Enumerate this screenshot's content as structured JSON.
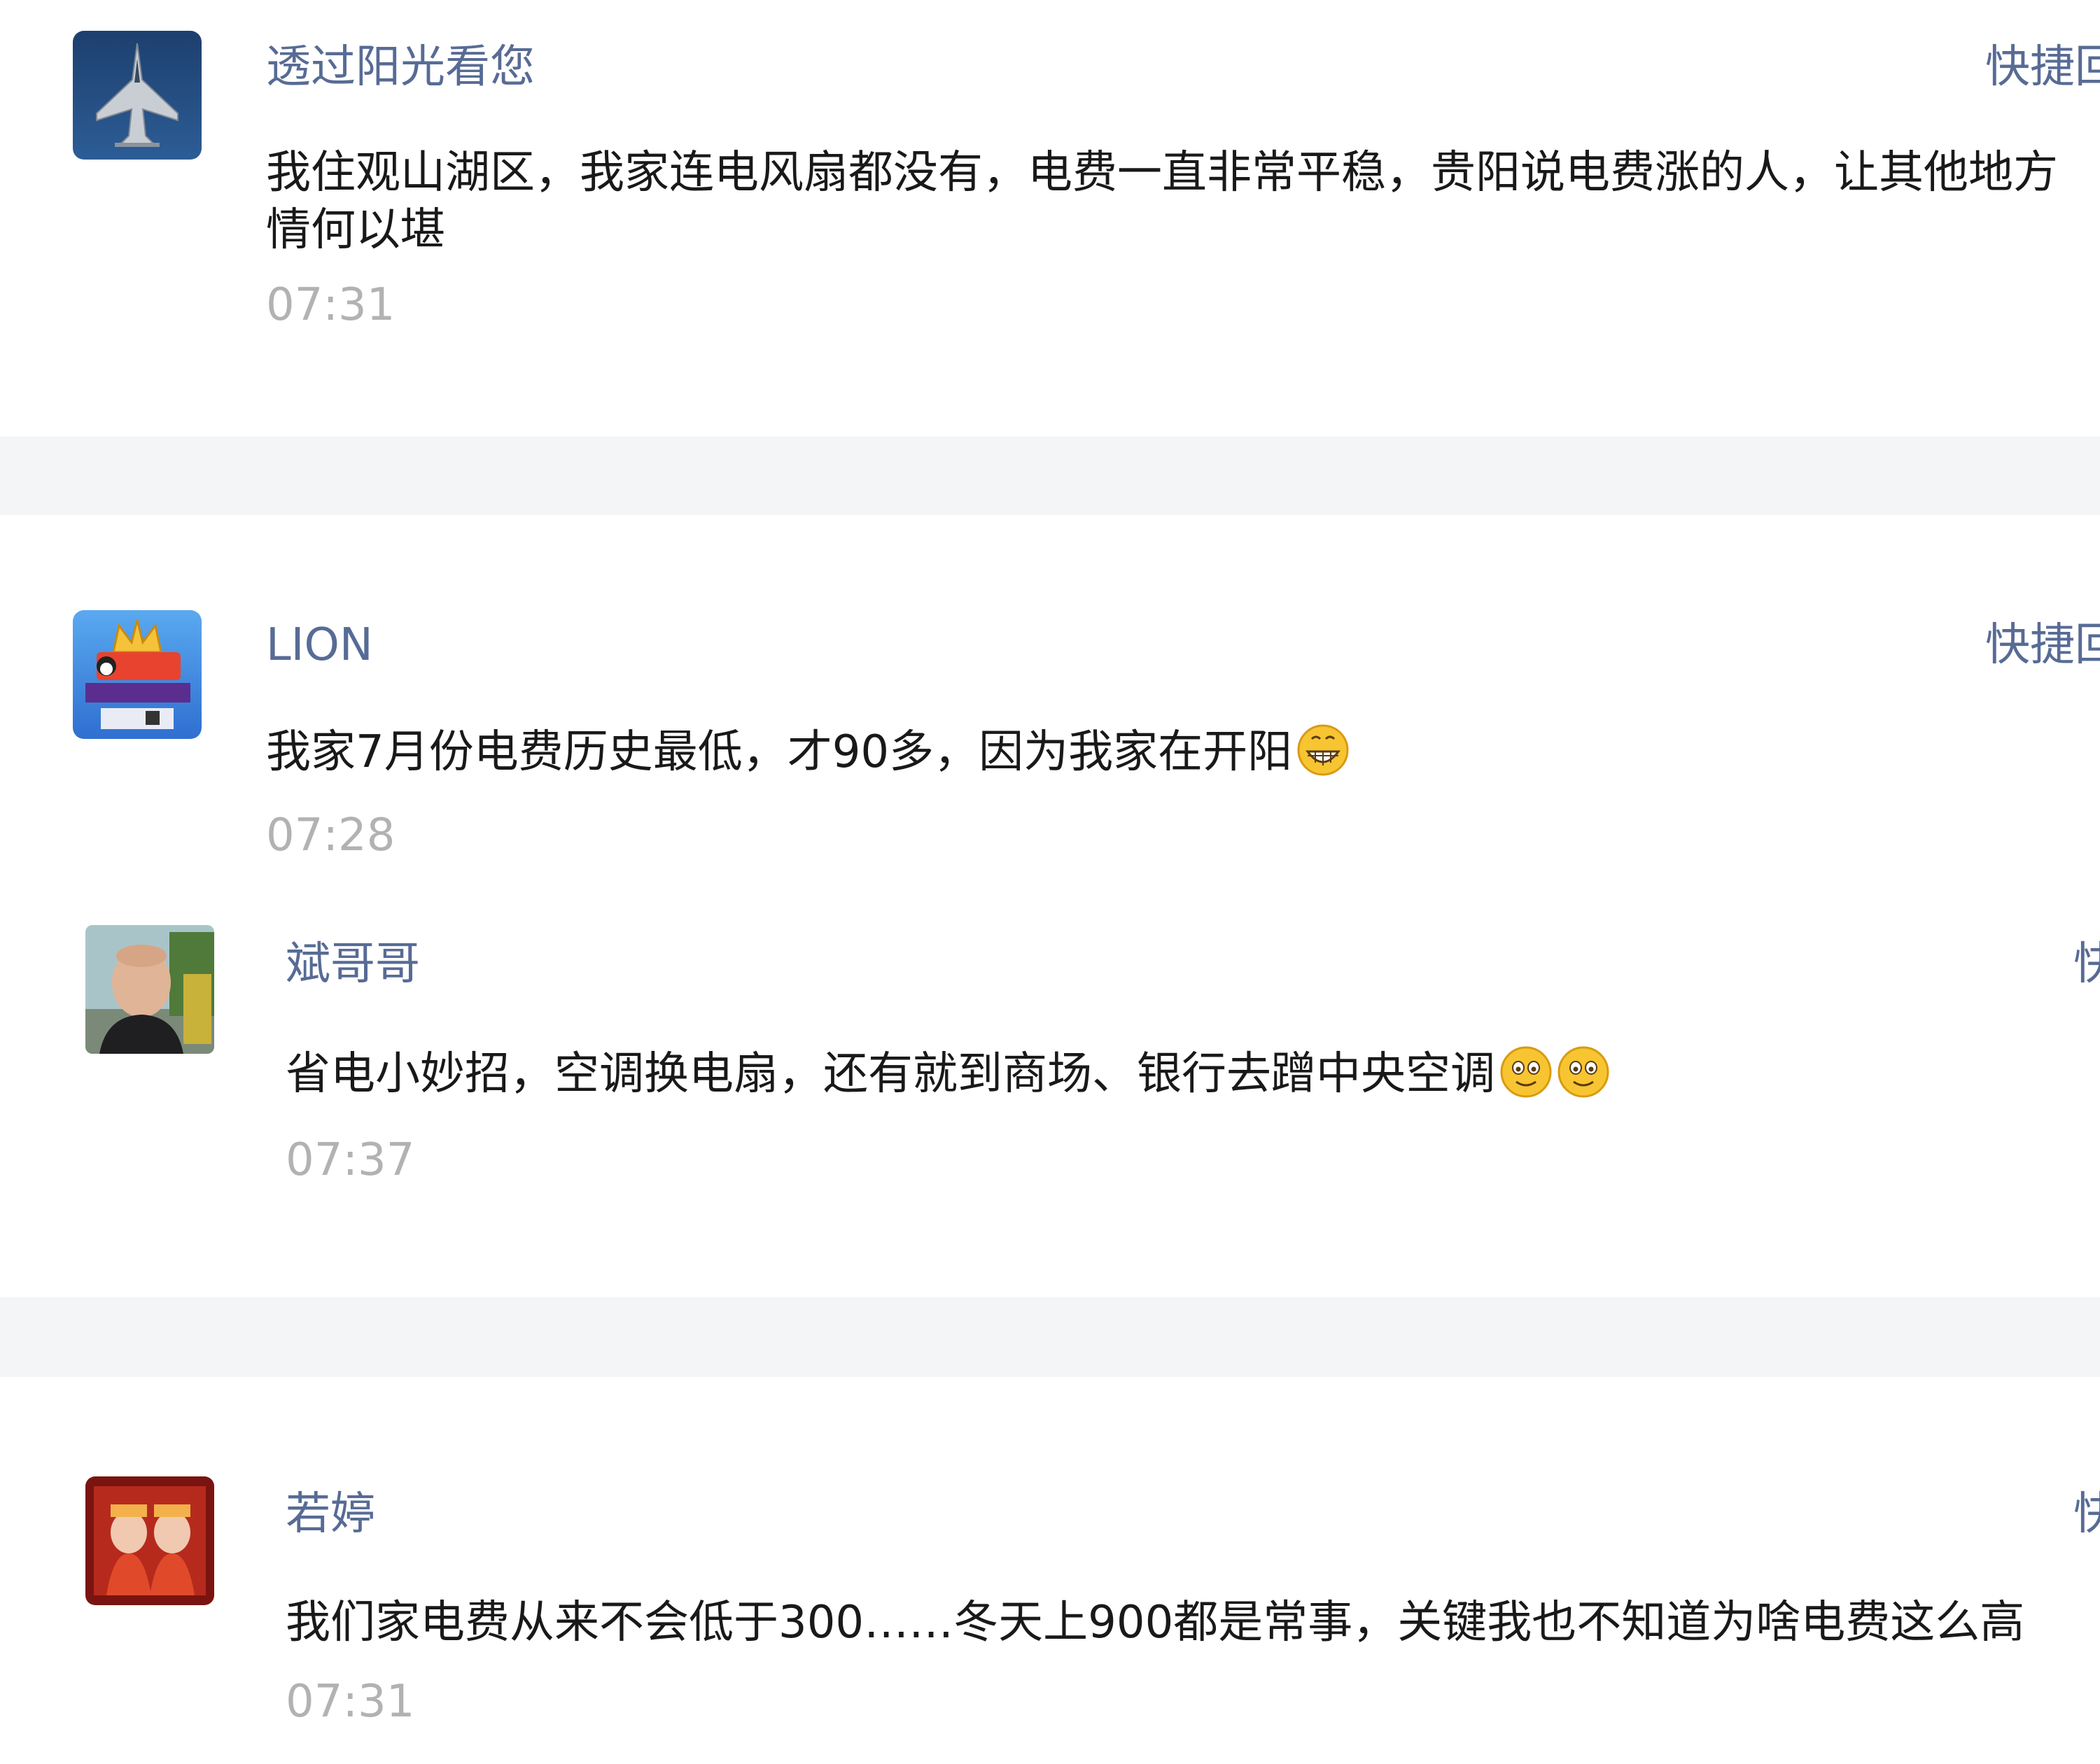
{
  "comments": [
    {
      "name": "透过阳光看您",
      "quick_reply": "快捷回",
      "content_line1": "我住观山湖区，我家连电风扇都没有，电费一直非常平稳，贵阳说电费涨的人，让其他地方",
      "content_line2": "情何以堪",
      "time": "07:31",
      "avatar_icon": "fighter-jet-avatar"
    },
    {
      "name": "LION",
      "quick_reply": "快捷回",
      "content": "我家7月份电费历史最低，才90多，因为我家在开阳",
      "emoji": "grinning-emoji",
      "time": "07:28",
      "avatar_icon": "champion-game-avatar"
    },
    {
      "name": "斌哥哥",
      "quick_reply": "快",
      "content": "省电小妙招，空调换电扇，还有就到商场、银行去蹭中央空调",
      "emoji": [
        "smile-emoji",
        "smile-emoji"
      ],
      "time": "07:37",
      "avatar_icon": "man-photo-avatar"
    },
    {
      "name": "若婷",
      "quick_reply": "快",
      "content": "我们家电费从来不会低于300……冬天上900都是常事，关键我也不知道为啥电费这么高",
      "time": "07:31",
      "avatar_icon": "red-portrait-avatar"
    }
  ],
  "colors": {
    "name": "#576b95",
    "content": "#191919",
    "time": "#b2b2b2",
    "separator": "#f4f5f7"
  }
}
